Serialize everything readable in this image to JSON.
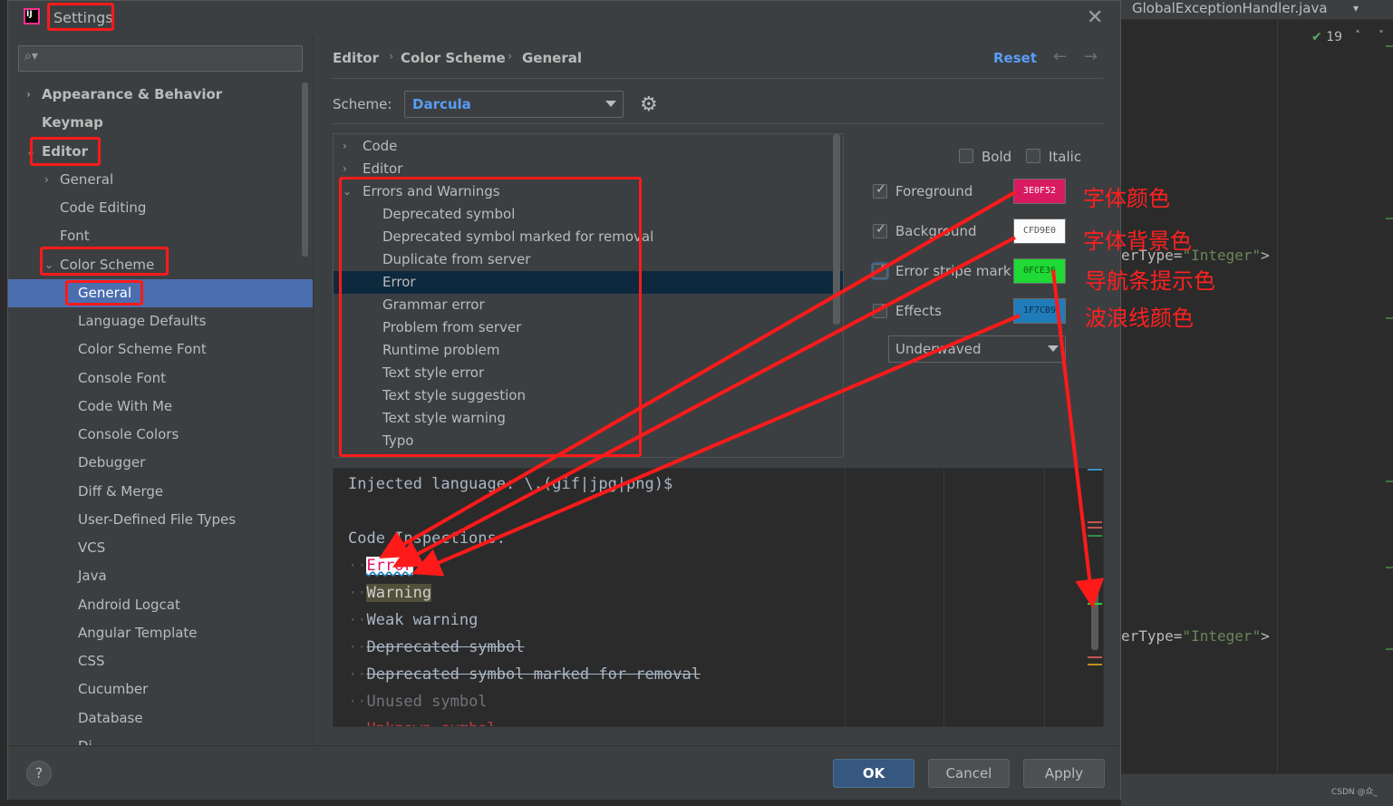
{
  "ide": {
    "tab_title": "GlobalExceptionHandler.java",
    "inspection_count": "19",
    "code_line1_pre": "erType=",
    "code_line1_str": "\"Integer\"",
    "code_line1_post": ">",
    "code_line2_pre": "erType=",
    "code_line2_str": "\"Integer\"",
    "code_line2_post": ">",
    "credit": "CSDN @众_"
  },
  "dialog": {
    "title": "Settings",
    "search_placeholder": ""
  },
  "sidebar": {
    "items": [
      {
        "label": "Appearance & Behavior",
        "arrow": "›"
      },
      {
        "label": "Keymap"
      },
      {
        "label": "Editor",
        "arrow": "⌄"
      },
      {
        "label": "General",
        "arrow": "›"
      },
      {
        "label": "Code Editing"
      },
      {
        "label": "Font"
      },
      {
        "label": "Color Scheme",
        "arrow": "⌄"
      },
      {
        "label": "General"
      },
      {
        "label": "Language Defaults"
      },
      {
        "label": "Color Scheme Font"
      },
      {
        "label": "Console Font"
      },
      {
        "label": "Code With Me"
      },
      {
        "label": "Console Colors"
      },
      {
        "label": "Debugger"
      },
      {
        "label": "Diff & Merge"
      },
      {
        "label": "User-Defined File Types"
      },
      {
        "label": "VCS"
      },
      {
        "label": "Java"
      },
      {
        "label": "Android Logcat"
      },
      {
        "label": "Angular Template"
      },
      {
        "label": "CSS"
      },
      {
        "label": "Cucumber"
      },
      {
        "label": "Database"
      },
      {
        "label": "Di..."
      }
    ]
  },
  "breadcrumb": {
    "items": [
      "Editor",
      "Color Scheme",
      "General"
    ],
    "separator": "›",
    "reset_label": "Reset",
    "back_icon": "←",
    "forward_icon": "→"
  },
  "scheme": {
    "label": "Scheme:",
    "value": "Darcula"
  },
  "attributes": {
    "items": [
      {
        "label": "Code",
        "arrow": "›"
      },
      {
        "label": "Editor",
        "arrow": "›"
      },
      {
        "label": "Errors and Warnings",
        "arrow": "⌄"
      },
      {
        "label": "Deprecated symbol"
      },
      {
        "label": "Deprecated symbol marked for removal"
      },
      {
        "label": "Duplicate from server"
      },
      {
        "label": "Error"
      },
      {
        "label": "Grammar error"
      },
      {
        "label": "Problem from server"
      },
      {
        "label": "Runtime problem"
      },
      {
        "label": "Text style error"
      },
      {
        "label": "Text style suggestion"
      },
      {
        "label": "Text style warning"
      },
      {
        "label": "Typo"
      }
    ]
  },
  "properties": {
    "bold_label": "Bold",
    "italic_label": "Italic",
    "foreground_label": "Foreground",
    "foreground_value": "3E0F52",
    "foreground_color": "#d81b60",
    "background_label": "Background",
    "background_value": "CFD9E0",
    "background_color": "#fcfcfc",
    "stripe_label": "Error stripe mark",
    "stripe_value": "0FCE36",
    "stripe_color": "#1ed936",
    "effects_label": "Effects",
    "effects_value": "1F7CB9",
    "effects_color": "#1f7cb9",
    "effects_type": "Underwaved"
  },
  "preview": {
    "line_injected": "Injected language: \\.(gif|jpg|png)$",
    "line_inspections": "Code Inspections:",
    "error": "Error",
    "warning": "Warning",
    "weak_warning": "Weak warning",
    "deprecated": "Deprecated symbol",
    "deprecated_removal": "Deprecated symbol marked for removal",
    "unused": "Unused symbol",
    "unknown": "Unknown symbol"
  },
  "footer": {
    "help_label": "?",
    "ok_label": "OK",
    "cancel_label": "Cancel",
    "apply_label": "Apply"
  },
  "annotations": {
    "font_color": "字体颜色",
    "font_bg": "字体背景色",
    "stripe": "导航条提示色",
    "wave": "波浪线颜色"
  }
}
